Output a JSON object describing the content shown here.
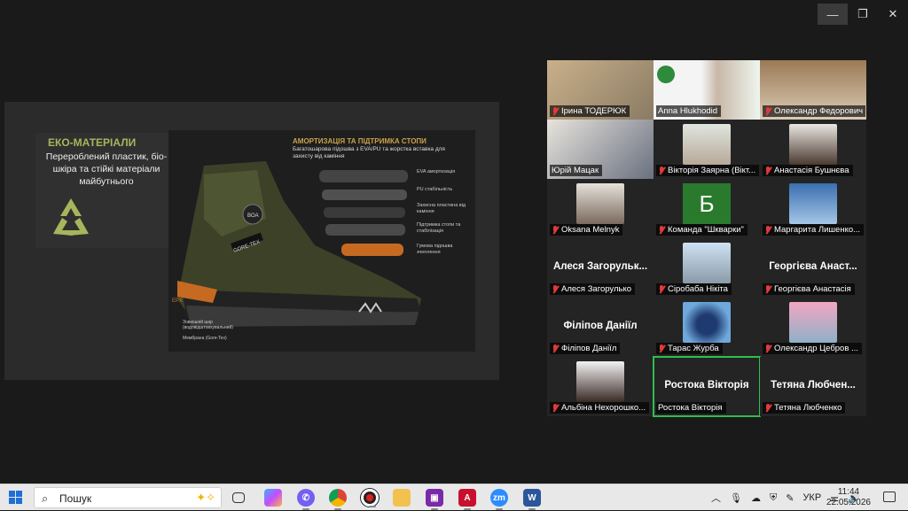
{
  "window": {
    "controls": [
      "—",
      "❐",
      "✕"
    ]
  },
  "share": {
    "eko_title": "ЕКО-МАТЕРІАЛИ",
    "eko_text": "Перероблений пластик, біо-шкіра та стійкі матеріали майбутнього",
    "amort_title": "АМОРТИЗАЦІЯ ТА ПІДТРИМКА СТОПИ",
    "amort_sub": "Багатошарова підошва з EVA/PU та жорстка вставка для захисту від каміння",
    "layers": [
      "EVA амортизація",
      "PU стабільність",
      "Захисна пластина від каміння",
      "Підтримка стопи та стабілізація",
      "Гумова підошва зчеплення"
    ],
    "bottom_labels": [
      "Зовнішній шар (водовідштовхувальний)",
      "Мембрана (Gore-Tex)"
    ],
    "tags": [
      "GORE-TEX",
      "BOA",
      "EPX"
    ]
  },
  "participants": [
    {
      "name": "Ірина ТОДЕРЮК",
      "big": "",
      "kind": "photo"
    },
    {
      "name": "Anna Hlukhodid",
      "big": "",
      "kind": "photo"
    },
    {
      "name": "Олександр Федорович",
      "big": "",
      "kind": "photo"
    },
    {
      "name": "Юрій Мацак",
      "big": "",
      "kind": "photo"
    },
    {
      "name": "Вікторія Заярна (Вікт...",
      "big": "",
      "kind": "avatar"
    },
    {
      "name": "Анастасія Бушнєва",
      "big": "",
      "kind": "avatar"
    },
    {
      "name": "Oksana Melnyk",
      "big": "",
      "kind": "avatar"
    },
    {
      "name": "Команда \"Шкварки\"",
      "big": "Б",
      "kind": "letter"
    },
    {
      "name": "Маргарита Лишенко...",
      "big": "",
      "kind": "avatar"
    },
    {
      "name": "Алеся Загорулько",
      "big": "Алеся Загорульк...",
      "kind": "name"
    },
    {
      "name": "Сіробаба Нікіта",
      "big": "",
      "kind": "avatar"
    },
    {
      "name": "Георгієва Анастасія",
      "big": "Георгієва Анаст...",
      "kind": "name"
    },
    {
      "name": "Філіпов Даніїл",
      "big": "Філіпов Даніїл",
      "kind": "name"
    },
    {
      "name": "Тарас Журба",
      "big": "",
      "kind": "avatar"
    },
    {
      "name": "Олександр Цебров ...",
      "big": "",
      "kind": "avatar"
    },
    {
      "name": "Альбіна Нехорошко...",
      "big": "",
      "kind": "avatar"
    },
    {
      "name": "Ростока Вікторія",
      "big": "Ростока Вікторія",
      "kind": "name"
    },
    {
      "name": "Тетяна Любченко",
      "big": "Тетяна Любчен...",
      "kind": "name"
    }
  ],
  "taskbar": {
    "search_placeholder": "Пошук",
    "lang": "УКР",
    "time": "11:44",
    "date": "22.05.2026",
    "apps": [
      "task-view",
      "copilot",
      "viber",
      "chrome",
      "recorder",
      "file-explorer",
      "save",
      "acrobat",
      "zoom",
      "word"
    ]
  },
  "colors": {
    "active_speaker": "#2fbf4f",
    "muted_mic": "#e03a3a",
    "eko_accent": "#a9b55c",
    "amort_accent": "#c9a24a"
  }
}
